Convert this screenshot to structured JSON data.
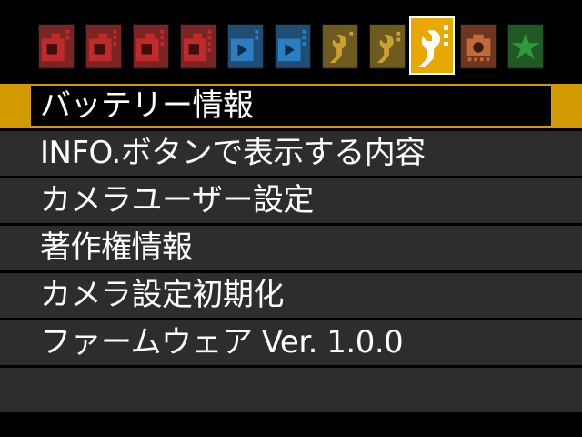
{
  "colors": {
    "shooting_tab": "#c22a2a",
    "playback_tab": "#2a7fc2",
    "setup_tab": "#c9a032",
    "active_tab": "#e8a800",
    "custom_tab": "#c26a3a",
    "mymenu_tab": "#2e9a3a",
    "highlight": "#d19a00"
  },
  "tabs": [
    {
      "icon": "camera-icon",
      "number": "1",
      "group": "shooting"
    },
    {
      "icon": "camera-icon",
      "number": "2",
      "group": "shooting"
    },
    {
      "icon": "camera-icon",
      "number": "3",
      "group": "shooting"
    },
    {
      "icon": "camera-icon",
      "number": "4",
      "group": "shooting"
    },
    {
      "icon": "playback-icon",
      "number": "1",
      "group": "playback"
    },
    {
      "icon": "playback-icon",
      "number": "2",
      "group": "playback"
    },
    {
      "icon": "wrench-icon",
      "number": "1",
      "group": "setup"
    },
    {
      "icon": "wrench-icon",
      "number": "2",
      "group": "setup"
    },
    {
      "icon": "wrench-icon",
      "number": "3",
      "group": "setup",
      "active": true
    },
    {
      "icon": "custom-function-icon",
      "number": "",
      "group": "custom"
    },
    {
      "icon": "star-icon",
      "number": "",
      "group": "my-menu"
    }
  ],
  "menu": {
    "items": [
      {
        "label": "バッテリー情報",
        "selected": true
      },
      {
        "label": "INFO.ボタンで表示する内容"
      },
      {
        "label": "カメラユーザー設定"
      },
      {
        "label": "著作権情報"
      },
      {
        "label": "カメラ設定初期化"
      },
      {
        "label": "ファームウェア Ver. 1.0.0"
      }
    ]
  }
}
